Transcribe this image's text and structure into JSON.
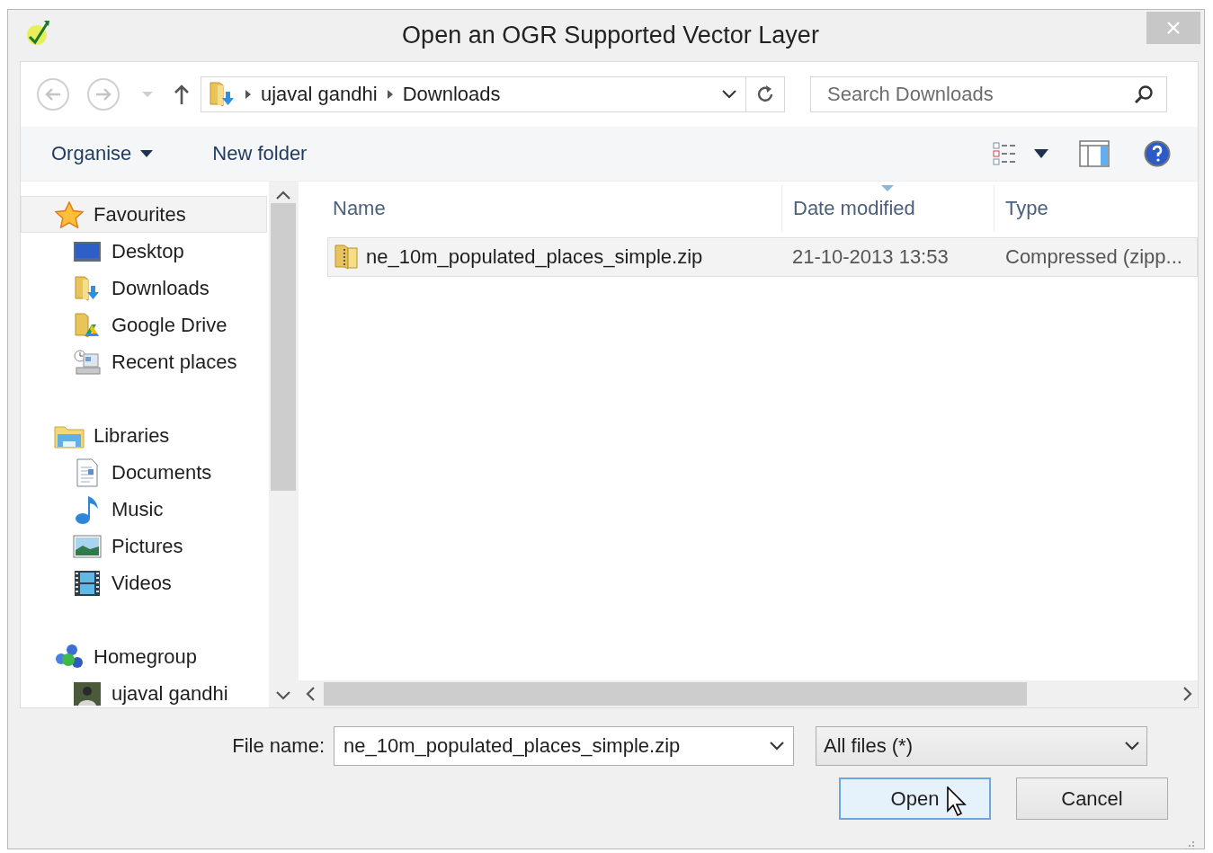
{
  "window": {
    "title": "Open an OGR Supported Vector Layer"
  },
  "address_bar": {
    "path": [
      "ujaval gandhi",
      "Downloads"
    ]
  },
  "search": {
    "placeholder": "Search Downloads"
  },
  "toolbar": {
    "buttons": [
      {
        "label": "Organise",
        "dropdown": true
      },
      {
        "label": "New folder",
        "dropdown": false
      }
    ]
  },
  "sidebar": {
    "groups": [
      {
        "label": "Favourites",
        "kind": "star",
        "selected": true,
        "children": [
          {
            "label": "Desktop",
            "kind": "desktop",
            "selected": false
          },
          {
            "label": "Downloads",
            "kind": "downloads",
            "selected": false
          },
          {
            "label": "Google Drive",
            "kind": "drive",
            "selected": false
          },
          {
            "label": "Recent places",
            "kind": "recent",
            "selected": false
          }
        ]
      },
      {
        "label": "Libraries",
        "kind": "libraries",
        "selected": false,
        "children": [
          {
            "label": "Documents",
            "kind": "documents",
            "selected": false
          },
          {
            "label": "Music",
            "kind": "music",
            "selected": false
          },
          {
            "label": "Pictures",
            "kind": "pictures",
            "selected": false
          },
          {
            "label": "Videos",
            "kind": "videos",
            "selected": false
          }
        ]
      },
      {
        "label": "Homegroup",
        "kind": "homegroup",
        "selected": false,
        "children": [
          {
            "label": "ujaval gandhi",
            "kind": "user",
            "selected": false
          }
        ]
      }
    ]
  },
  "file_list": {
    "columns": [
      {
        "label": "Name",
        "sorted": false
      },
      {
        "label": "Date modified",
        "sorted": true
      },
      {
        "label": "Type",
        "sorted": false
      }
    ],
    "rows": [
      {
        "name": "ne_10m_populated_places_simple.zip",
        "date_modified": "21-10-2013 13:53",
        "type": "Compressed (zipp...",
        "selected": true
      }
    ]
  },
  "file_name": {
    "label": "File name:",
    "value": "ne_10m_populated_places_simple.zip"
  },
  "file_type": {
    "value": "All files (*)"
  },
  "buttons": [
    {
      "label": "Open",
      "default": true
    },
    {
      "label": "Cancel",
      "default": false
    }
  ]
}
